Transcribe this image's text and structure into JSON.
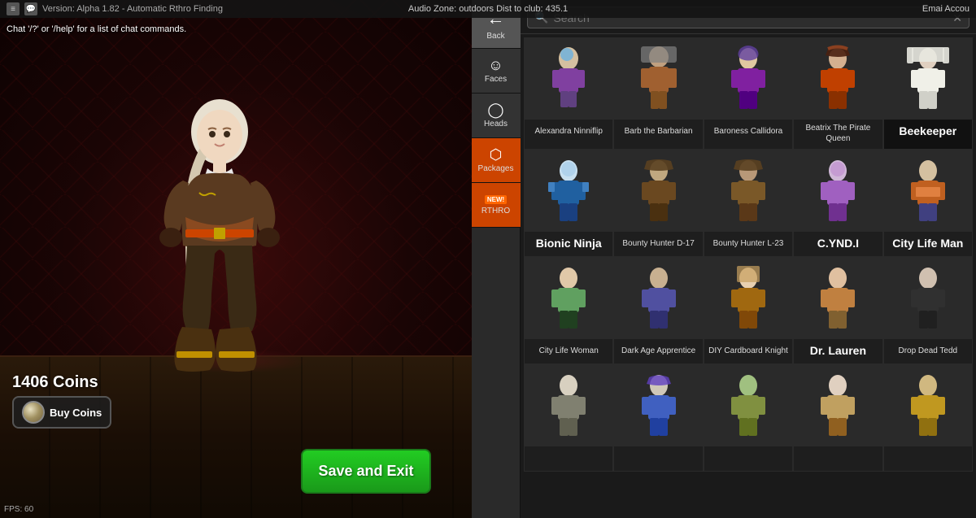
{
  "topbar": {
    "version": "Version: Alpha 1.82 - Automatic Rthro Finding",
    "audio_zone": "Audio Zone: outdoors Dist to club: 435.1",
    "email_label": "Emai Accou"
  },
  "chat": {
    "text": "Chat '/?' or '/help' for a list of chat commands."
  },
  "player": {
    "coins": "1406 Coins",
    "buy_coins_label": "Buy Coins",
    "fps": "FPS: 60"
  },
  "save_exit": {
    "label": "Save and Exit"
  },
  "side_nav": {
    "back": "←",
    "items": [
      {
        "id": "back",
        "label": "Back",
        "icon": "←"
      },
      {
        "id": "faces",
        "label": "Faces",
        "icon": "☺"
      },
      {
        "id": "heads",
        "label": "Heads",
        "icon": "⊙"
      },
      {
        "id": "packages",
        "label": "Packages",
        "icon": "⬡"
      },
      {
        "id": "rthro",
        "label": "RTHRO",
        "icon": "★",
        "new": true
      }
    ]
  },
  "search": {
    "placeholder": "Search",
    "value": ""
  },
  "items": [
    {
      "id": 1,
      "name": "Alexandra Ninniflip",
      "bold": false
    },
    {
      "id": 2,
      "name": "Barb the Barbarian",
      "bold": false
    },
    {
      "id": 3,
      "name": "Baroness Callidora",
      "bold": false
    },
    {
      "id": 4,
      "name": "Beatrix The Pirate Queen",
      "bold": false
    },
    {
      "id": 5,
      "name": "Beekeeper",
      "bold": true
    },
    {
      "id": 6,
      "name": "Bionic Ninja",
      "bold": true
    },
    {
      "id": 7,
      "name": "Bounty Hunter D-17",
      "bold": false
    },
    {
      "id": 8,
      "name": "Bounty Hunter L-23",
      "bold": false
    },
    {
      "id": 9,
      "name": "C.YND.I",
      "bold": true
    },
    {
      "id": 10,
      "name": "City Life Man",
      "bold": true
    },
    {
      "id": 11,
      "name": "City Life Woman",
      "bold": false
    },
    {
      "id": 12,
      "name": "Dark Age Apprentice",
      "bold": false
    },
    {
      "id": 13,
      "name": "DIY Cardboard Knight",
      "bold": false
    },
    {
      "id": 14,
      "name": "Dr. Lauren",
      "bold": true
    },
    {
      "id": 15,
      "name": "Drop Dead Tedd",
      "bold": false
    },
    {
      "id": 16,
      "name": "",
      "bold": false
    },
    {
      "id": 17,
      "name": "",
      "bold": false
    },
    {
      "id": 18,
      "name": "",
      "bold": false
    },
    {
      "id": 19,
      "name": "",
      "bold": false
    },
    {
      "id": 20,
      "name": "",
      "bold": false
    }
  ],
  "colors": {
    "accent_orange": "#cc4400",
    "save_green": "#22cc22",
    "bg_dark": "#1a1a1a",
    "panel_bg": "#2a2a2a"
  }
}
